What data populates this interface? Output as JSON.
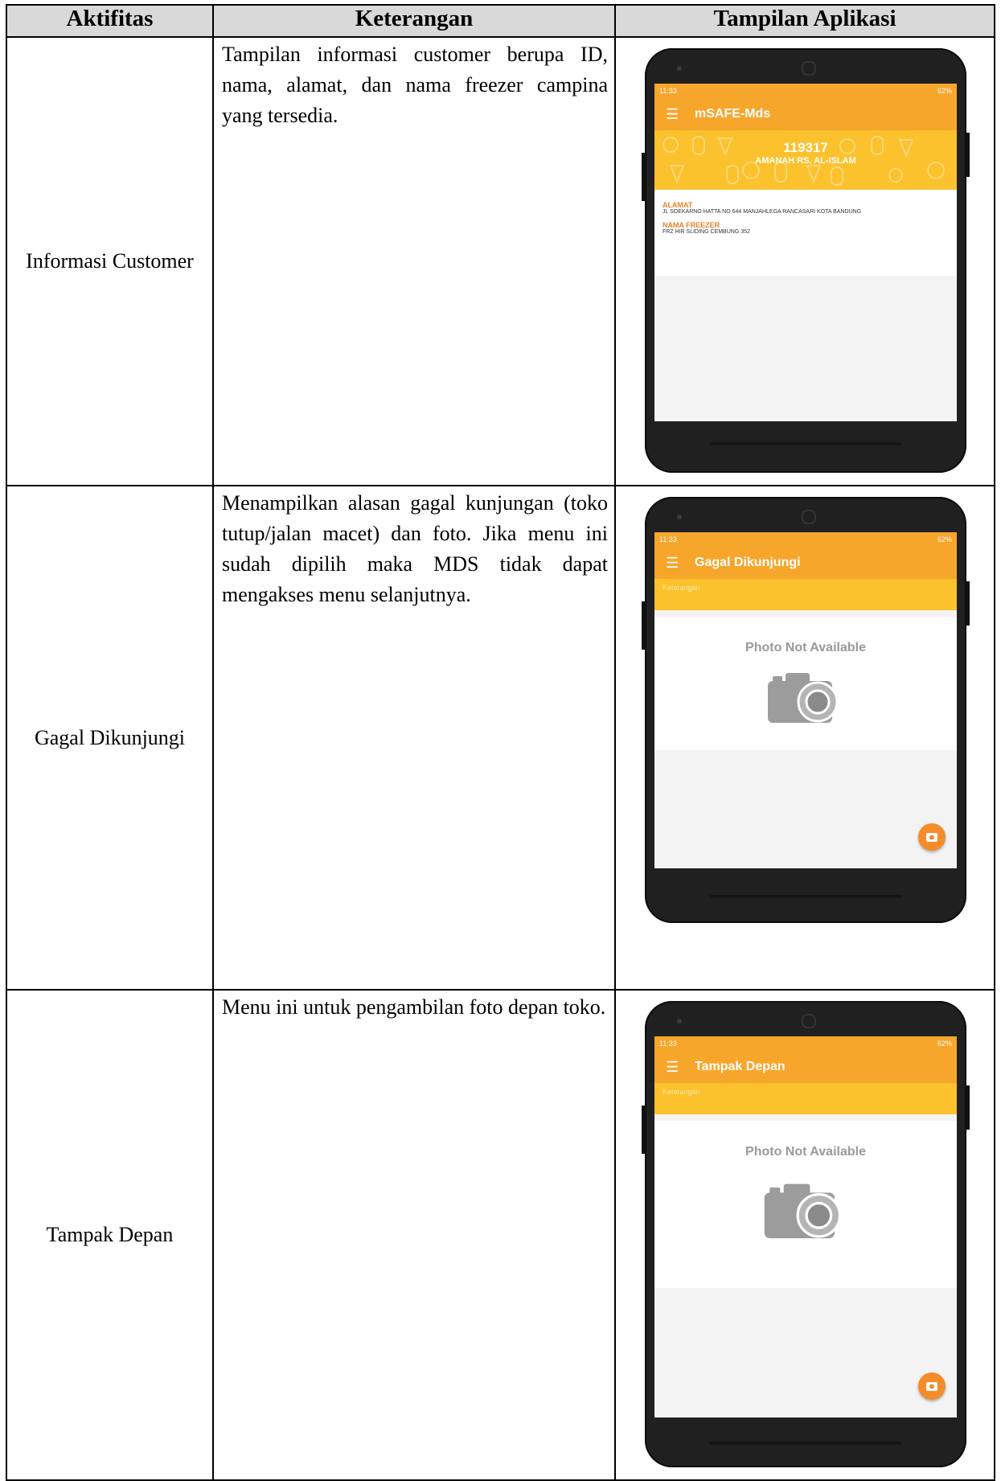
{
  "headers": [
    "Aktifitas",
    "Keterangan",
    "Tampilan Aplikasi"
  ],
  "rows": [
    {
      "activity": "Informasi Customer",
      "description": "Tampilan informasi customer berupa ID, nama, alamat, dan nama freezer campina yang tersedia.",
      "screen": {
        "status_time": "11:33",
        "status_battery": "62%",
        "title": "mSAFE-Mds",
        "customer_id": "119317",
        "customer_name": "AMANAH RS. AL-ISLAM",
        "address_label": "ALAMAT",
        "address_value": "JL SOEKARNO HATTA NO 644 MANJAHLEGA RANCASARI KOTA BANDUNG",
        "freezer_label": "NAMA FREEZER",
        "freezer_value": "FRZ HIR SLIDING CEMBUNG 352"
      }
    },
    {
      "activity": "Gagal Dikunjungi",
      "description": "Menampilkan alasan gagal kunjungan (toko tutup/jalan macet) dan foto. Jika menu ini sudah dipilih maka MDS tidak dapat mengakses menu selanjutnya.",
      "screen": {
        "status_time": "11:33",
        "status_battery": "62%",
        "title": "Gagal Dikunjungi",
        "field_placeholder": "Keterangan",
        "photo_text": "Photo Not Available"
      }
    },
    {
      "activity": "Tampak Depan",
      "description": "Menu ini untuk pengambilan foto depan toko.",
      "screen": {
        "status_time": "11:33",
        "status_battery": "62%",
        "title": "Tampak Depan",
        "field_placeholder": "Keterangan",
        "photo_text": "Photo Not Available"
      }
    }
  ],
  "colors": {
    "appbar": "#f7a62c",
    "banner": "#fbc22d",
    "accent": "#e8822b",
    "fab": "#f58c2a",
    "header_bg": "#d9d9d9"
  },
  "icons": {
    "menu": "hamburger-menu-icon",
    "camera": "camera-icon",
    "fab": "camera-fab-icon"
  }
}
